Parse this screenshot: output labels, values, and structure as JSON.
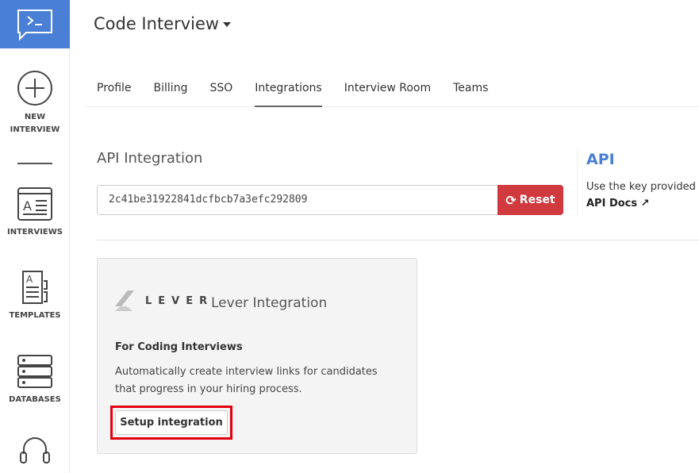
{
  "sidebar": {
    "items": [
      {
        "label": "NEW INTERVIEW",
        "icon": "plus-circle-icon"
      },
      {
        "label": "INTERVIEWS",
        "icon": "interviews-icon"
      },
      {
        "label": "TEMPLATES",
        "icon": "templates-icon"
      },
      {
        "label": "DATABASES",
        "icon": "database-icon"
      },
      {
        "label": "",
        "icon": "headset-icon"
      }
    ]
  },
  "header": {
    "title": "Code Interview"
  },
  "tabs": [
    {
      "label": "Profile"
    },
    {
      "label": "Billing"
    },
    {
      "label": "SSO"
    },
    {
      "label": "Integrations",
      "active": true
    },
    {
      "label": "Interview Room"
    },
    {
      "label": "Teams"
    }
  ],
  "api": {
    "heading": "API Integration",
    "key": "2c41be31922841dcfbcb7a3efc292809",
    "reset_label": "Reset",
    "side_heading": "API",
    "side_text": "Use the key provided t",
    "docs_label": "API Docs"
  },
  "lever": {
    "logo_text": "LEVER",
    "title": "Lever Integration",
    "subheading": "For Coding Interviews",
    "description": "Automatically create interview links for candidates that progress in your hiring process.",
    "setup_label": "Setup integration"
  },
  "colors": {
    "brand": "#4a7fd6",
    "danger": "#d0393e",
    "highlight": "#e4000f"
  }
}
